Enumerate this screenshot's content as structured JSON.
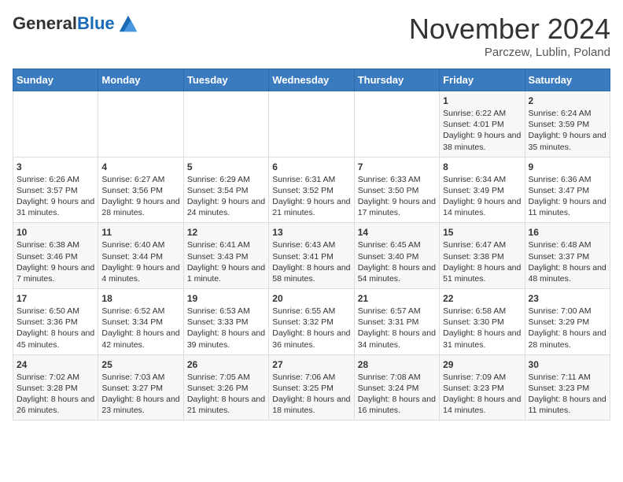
{
  "header": {
    "logo_general": "General",
    "logo_blue": "Blue",
    "month_title": "November 2024",
    "subtitle": "Parczew, Lublin, Poland"
  },
  "weekdays": [
    "Sunday",
    "Monday",
    "Tuesday",
    "Wednesday",
    "Thursday",
    "Friday",
    "Saturday"
  ],
  "weeks": [
    [
      {
        "day": "",
        "text": ""
      },
      {
        "day": "",
        "text": ""
      },
      {
        "day": "",
        "text": ""
      },
      {
        "day": "",
        "text": ""
      },
      {
        "day": "",
        "text": ""
      },
      {
        "day": "1",
        "text": "Sunrise: 6:22 AM\nSunset: 4:01 PM\nDaylight: 9 hours and 38 minutes."
      },
      {
        "day": "2",
        "text": "Sunrise: 6:24 AM\nSunset: 3:59 PM\nDaylight: 9 hours and 35 minutes."
      }
    ],
    [
      {
        "day": "3",
        "text": "Sunrise: 6:26 AM\nSunset: 3:57 PM\nDaylight: 9 hours and 31 minutes."
      },
      {
        "day": "4",
        "text": "Sunrise: 6:27 AM\nSunset: 3:56 PM\nDaylight: 9 hours and 28 minutes."
      },
      {
        "day": "5",
        "text": "Sunrise: 6:29 AM\nSunset: 3:54 PM\nDaylight: 9 hours and 24 minutes."
      },
      {
        "day": "6",
        "text": "Sunrise: 6:31 AM\nSunset: 3:52 PM\nDaylight: 9 hours and 21 minutes."
      },
      {
        "day": "7",
        "text": "Sunrise: 6:33 AM\nSunset: 3:50 PM\nDaylight: 9 hours and 17 minutes."
      },
      {
        "day": "8",
        "text": "Sunrise: 6:34 AM\nSunset: 3:49 PM\nDaylight: 9 hours and 14 minutes."
      },
      {
        "day": "9",
        "text": "Sunrise: 6:36 AM\nSunset: 3:47 PM\nDaylight: 9 hours and 11 minutes."
      }
    ],
    [
      {
        "day": "10",
        "text": "Sunrise: 6:38 AM\nSunset: 3:46 PM\nDaylight: 9 hours and 7 minutes."
      },
      {
        "day": "11",
        "text": "Sunrise: 6:40 AM\nSunset: 3:44 PM\nDaylight: 9 hours and 4 minutes."
      },
      {
        "day": "12",
        "text": "Sunrise: 6:41 AM\nSunset: 3:43 PM\nDaylight: 9 hours and 1 minute."
      },
      {
        "day": "13",
        "text": "Sunrise: 6:43 AM\nSunset: 3:41 PM\nDaylight: 8 hours and 58 minutes."
      },
      {
        "day": "14",
        "text": "Sunrise: 6:45 AM\nSunset: 3:40 PM\nDaylight: 8 hours and 54 minutes."
      },
      {
        "day": "15",
        "text": "Sunrise: 6:47 AM\nSunset: 3:38 PM\nDaylight: 8 hours and 51 minutes."
      },
      {
        "day": "16",
        "text": "Sunrise: 6:48 AM\nSunset: 3:37 PM\nDaylight: 8 hours and 48 minutes."
      }
    ],
    [
      {
        "day": "17",
        "text": "Sunrise: 6:50 AM\nSunset: 3:36 PM\nDaylight: 8 hours and 45 minutes."
      },
      {
        "day": "18",
        "text": "Sunrise: 6:52 AM\nSunset: 3:34 PM\nDaylight: 8 hours and 42 minutes."
      },
      {
        "day": "19",
        "text": "Sunrise: 6:53 AM\nSunset: 3:33 PM\nDaylight: 8 hours and 39 minutes."
      },
      {
        "day": "20",
        "text": "Sunrise: 6:55 AM\nSunset: 3:32 PM\nDaylight: 8 hours and 36 minutes."
      },
      {
        "day": "21",
        "text": "Sunrise: 6:57 AM\nSunset: 3:31 PM\nDaylight: 8 hours and 34 minutes."
      },
      {
        "day": "22",
        "text": "Sunrise: 6:58 AM\nSunset: 3:30 PM\nDaylight: 8 hours and 31 minutes."
      },
      {
        "day": "23",
        "text": "Sunrise: 7:00 AM\nSunset: 3:29 PM\nDaylight: 8 hours and 28 minutes."
      }
    ],
    [
      {
        "day": "24",
        "text": "Sunrise: 7:02 AM\nSunset: 3:28 PM\nDaylight: 8 hours and 26 minutes."
      },
      {
        "day": "25",
        "text": "Sunrise: 7:03 AM\nSunset: 3:27 PM\nDaylight: 8 hours and 23 minutes."
      },
      {
        "day": "26",
        "text": "Sunrise: 7:05 AM\nSunset: 3:26 PM\nDaylight: 8 hours and 21 minutes."
      },
      {
        "day": "27",
        "text": "Sunrise: 7:06 AM\nSunset: 3:25 PM\nDaylight: 8 hours and 18 minutes."
      },
      {
        "day": "28",
        "text": "Sunrise: 7:08 AM\nSunset: 3:24 PM\nDaylight: 8 hours and 16 minutes."
      },
      {
        "day": "29",
        "text": "Sunrise: 7:09 AM\nSunset: 3:23 PM\nDaylight: 8 hours and 14 minutes."
      },
      {
        "day": "30",
        "text": "Sunrise: 7:11 AM\nSunset: 3:23 PM\nDaylight: 8 hours and 11 minutes."
      }
    ]
  ]
}
